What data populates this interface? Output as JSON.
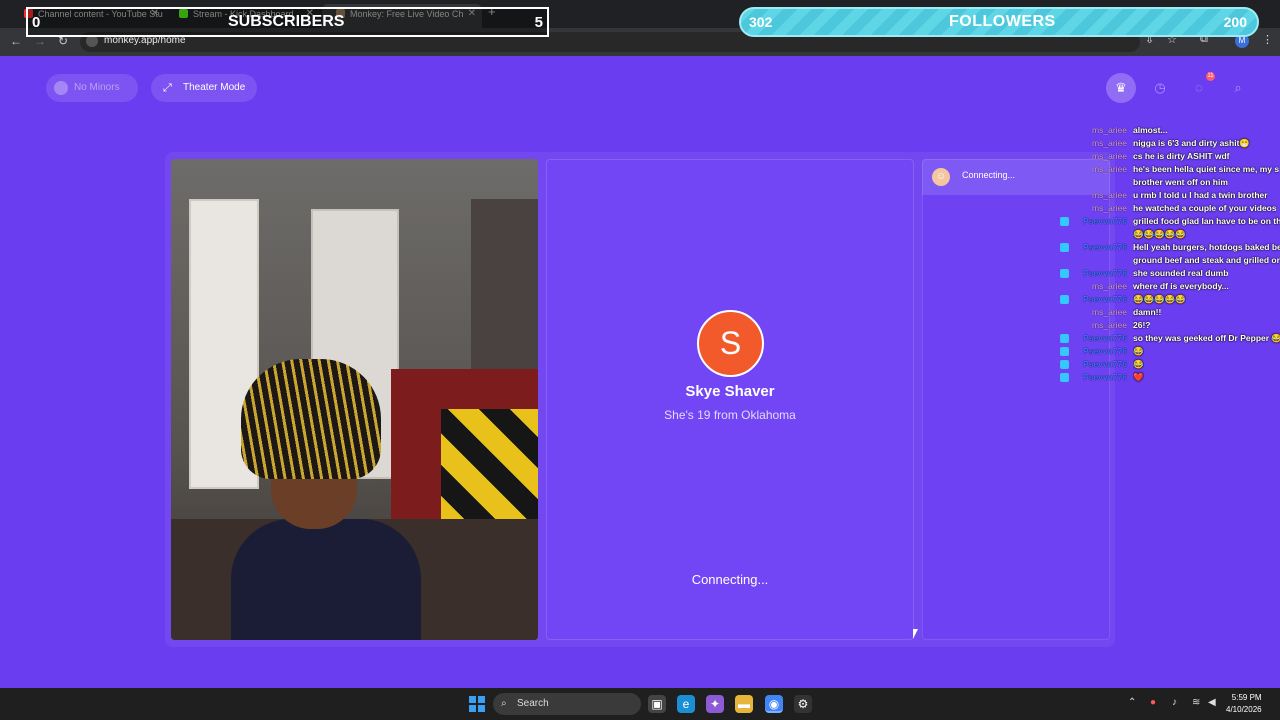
{
  "browser": {
    "tabs": [
      {
        "title": "Channel content - YouTube Stu",
        "favicon_color": "#ff2b2b"
      },
      {
        "title": "Stream - Kick Dashboard",
        "favicon_color": "#53fc18"
      },
      {
        "title": "Monkey: Free Live Video Ch",
        "favicon_color": "#9a7b5a"
      }
    ],
    "url": "monkey.app/home"
  },
  "overlay": {
    "subscribers_left": "0",
    "subscribers_title": "SUBSCRIBERS",
    "subscribers_right": "5",
    "followers_left": "302",
    "followers_title": "FOLLOWERS",
    "followers_right": "200"
  },
  "topbar": {
    "no_minors_label": "No Minors",
    "theater_label": "Theater Mode",
    "notif_count": "11"
  },
  "remote": {
    "avatar_letter": "S",
    "name": "Skye Shaver",
    "desc": "She's 19 from Oklahoma",
    "status": "Connecting..."
  },
  "side": {
    "status": "Connecting..."
  },
  "chat": [
    {
      "user": "ms_ariee",
      "msg": "almost...",
      "blue": false
    },
    {
      "user": "ms_ariee",
      "msg": "nigga is 6'3 and dirty ashit😁",
      "blue": false
    },
    {
      "user": "ms_ariee",
      "msg": "cs he is dirty ASHIT wdf",
      "blue": false
    },
    {
      "user": "ms_ariee",
      "msg": "he's been hella quiet since me, my s",
      "blue": false
    },
    {
      "user": "",
      "msg": "brother went off on him",
      "blue": false
    },
    {
      "user": "ms_ariee",
      "msg": "u rmb I told u I had a twin brother",
      "blue": false
    },
    {
      "user": "ms_ariee",
      "msg": "he watched a couple of your videos",
      "blue": false
    },
    {
      "user": "Psevvn776",
      "msg": "grilled food glad Ian have to be on th",
      "blue": true
    },
    {
      "user": "",
      "msg": "😂😂😂😂😂",
      "blue": false
    },
    {
      "user": "Psevvn776",
      "msg": "Hell yeah burgers, hotdogs baked be",
      "blue": true
    },
    {
      "user": "",
      "msg": "ground beef and steak and grilled or",
      "blue": false
    },
    {
      "user": "Psevvn776",
      "msg": "she sounded real dumb",
      "blue": true
    },
    {
      "user": "ms_ariee",
      "msg": "where df is everybody...",
      "blue": false
    },
    {
      "user": "Psevvn776",
      "msg": "😂😂😂😂😂",
      "blue": true
    },
    {
      "user": "ms_ariee",
      "msg": "damn!!",
      "blue": false
    },
    {
      "user": "ms_ariee",
      "msg": "26!?",
      "blue": false
    },
    {
      "user": "Psevvn776",
      "msg": "so they was geeked off Dr Pepper 😂",
      "blue": true
    },
    {
      "user": "Psevvn776",
      "msg": "😂",
      "blue": true
    },
    {
      "user": "Psevvn776",
      "msg": "😂",
      "blue": true
    },
    {
      "user": "Psevvn776",
      "msg": "❤️",
      "blue": true
    }
  ],
  "taskbar": {
    "search_label": "Search",
    "time": "5:59 PM",
    "date": "4/10/2026"
  },
  "colors": {
    "page_bg": "#6b3df0",
    "avatar_bg": "#f25a2c",
    "followers_bg": "#5fd6e6"
  }
}
